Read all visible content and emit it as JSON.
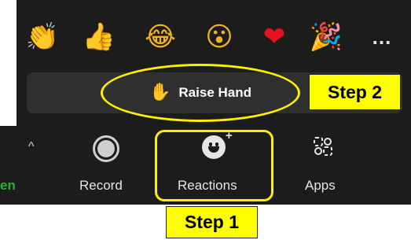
{
  "reactions": {
    "emojis": [
      {
        "name": "clapping-hands",
        "glyph": "👏"
      },
      {
        "name": "thumbs-up",
        "glyph": "👍"
      },
      {
        "name": "tears-of-joy",
        "glyph": "😂"
      },
      {
        "name": "open-mouth",
        "glyph": "😮"
      },
      {
        "name": "red-heart",
        "glyph": "❤"
      },
      {
        "name": "party-popper",
        "glyph": "🎉"
      }
    ],
    "more_label": "...",
    "raise_hand_label": "Raise Hand",
    "raise_hand_glyph": "✋"
  },
  "annotations": {
    "step1": "Step 1",
    "step2": "Step 2"
  },
  "toolbar": {
    "partial_label": "en",
    "record_label": "Record",
    "reactions_label": "Reactions",
    "apps_label": "Apps",
    "chevron_glyph": "^"
  },
  "colors": {
    "panel_bg": "#1c1c1c",
    "highlight": "#ffee00",
    "step_bg": "#ffff00",
    "green_text": "#25b33a"
  }
}
